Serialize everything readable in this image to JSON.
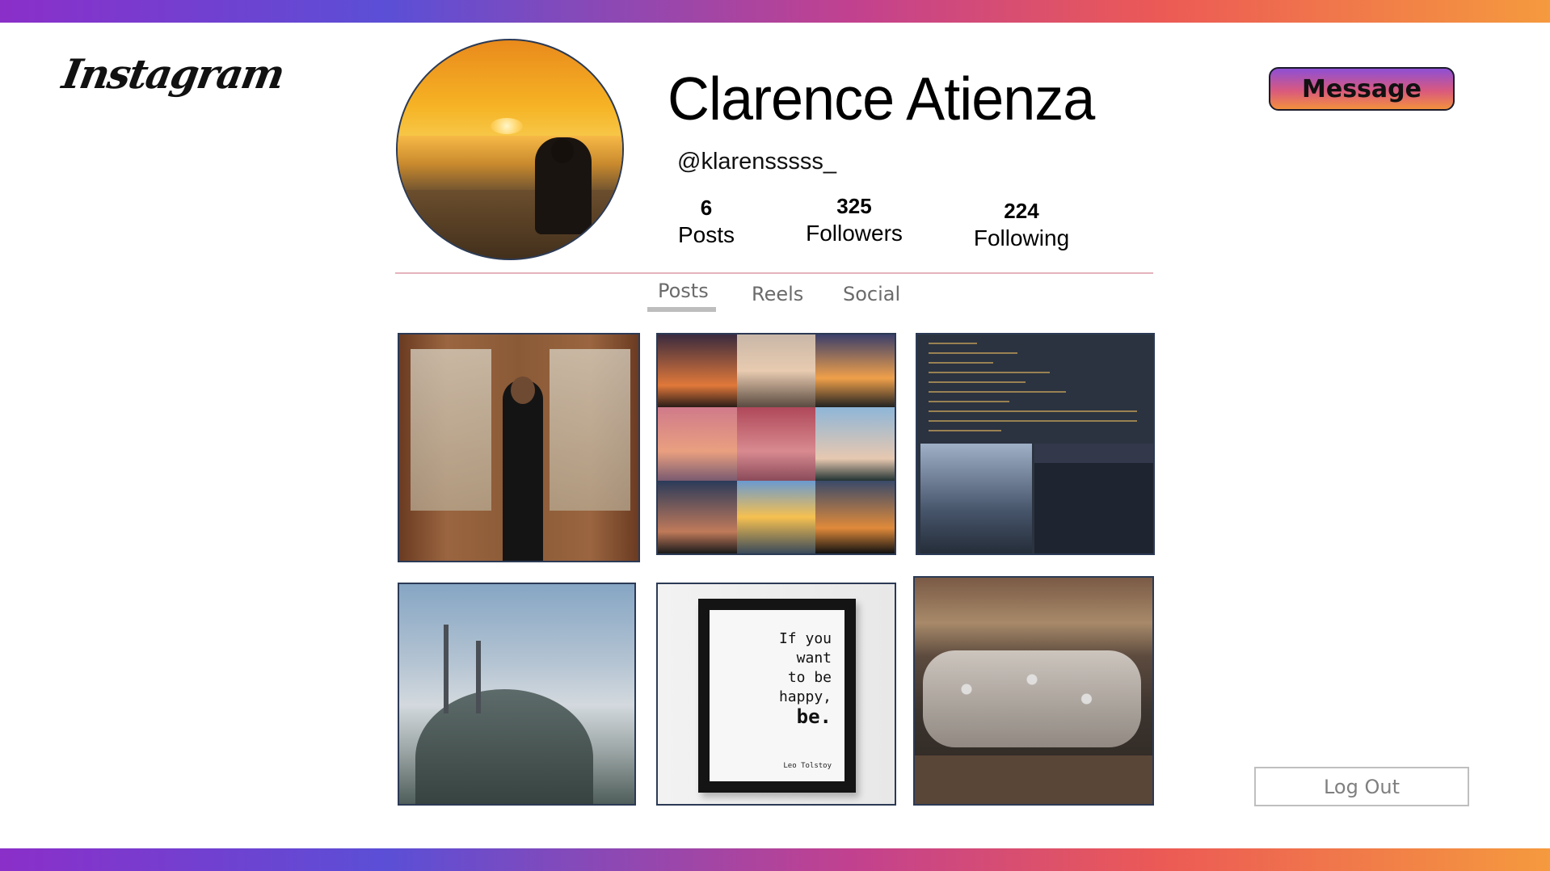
{
  "app": {
    "logo_text": "Instagram"
  },
  "profile": {
    "name": "Clarence Atienza",
    "handle": "@klarensssss_",
    "stats": [
      {
        "value": "6",
        "label": "Posts"
      },
      {
        "value": "325",
        "label": "Followers"
      },
      {
        "value": "224",
        "label": "Following"
      }
    ]
  },
  "actions": {
    "message_label": "Message",
    "logout_label": "Log Out"
  },
  "tabs": [
    {
      "label": "Posts",
      "active": true
    },
    {
      "label": "Reels",
      "active": false
    },
    {
      "label": "Social",
      "active": false
    }
  ],
  "posts": {
    "quote_lines": [
      "If you",
      "want",
      "to be",
      "happy,",
      "be."
    ],
    "quote_author": "Leo Tolstoy"
  },
  "colors": {
    "gradient": [
      "#8b2fc9",
      "#5b4fd6",
      "#c2418f",
      "#ec5a55",
      "#f59a3e"
    ],
    "divider": "#e6b3bd",
    "tab_text": "#6b6b6b"
  }
}
